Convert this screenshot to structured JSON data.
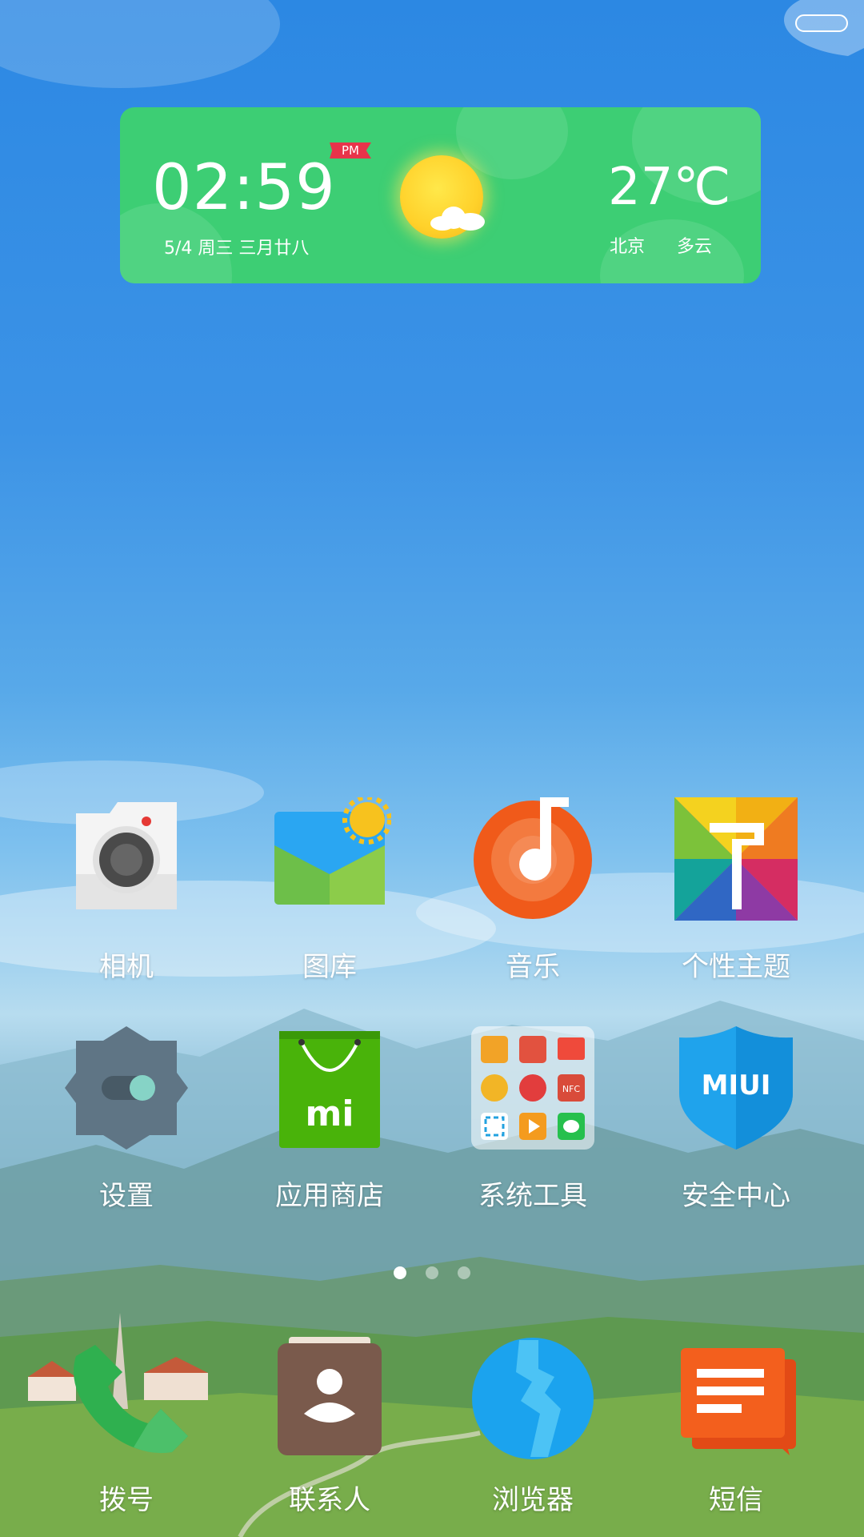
{
  "widget": {
    "time": "02:59",
    "ampm": "PM",
    "date": "5/4 周三 三月廿八",
    "temperature": "27℃",
    "city": "北京",
    "condition": "多云",
    "weather_icon": "partly-cloudy-icon",
    "accent": "#3dce74"
  },
  "apps": [
    {
      "label": "相机",
      "icon": "camera-icon"
    },
    {
      "label": "图库",
      "icon": "gallery-icon"
    },
    {
      "label": "音乐",
      "icon": "music-icon"
    },
    {
      "label": "个性主题",
      "icon": "themes-icon"
    },
    {
      "label": "设置",
      "icon": "settings-gear-icon"
    },
    {
      "label": "应用商店",
      "icon": "app-store-bag-icon"
    },
    {
      "label": "系统工具",
      "icon": "system-tools-folder-icon"
    },
    {
      "label": "安全中心",
      "icon": "security-shield-icon"
    }
  ],
  "dock": [
    {
      "label": "拨号",
      "icon": "phone-icon"
    },
    {
      "label": "联系人",
      "icon": "contacts-icon"
    },
    {
      "label": "浏览器",
      "icon": "browser-globe-icon"
    },
    {
      "label": "短信",
      "icon": "messages-icon"
    }
  ],
  "page_indicator": {
    "pages": 3,
    "current": 1
  },
  "folder_badge": "NFC",
  "security_badge": "MIUI",
  "store_badge": "mi"
}
